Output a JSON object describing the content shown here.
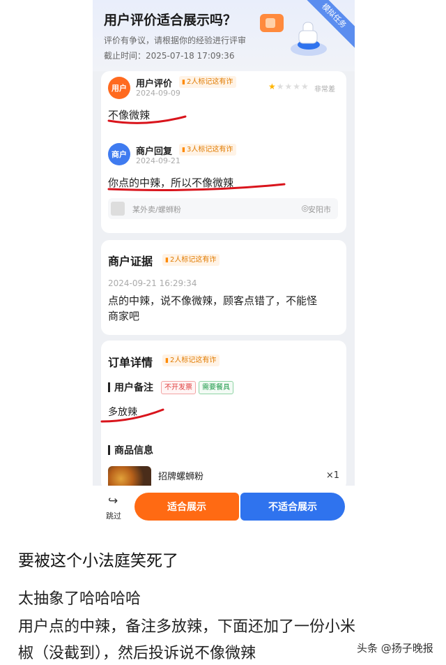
{
  "header": {
    "title": "用户评价适合展示吗？",
    "subtitle": "评价有争议，请根据你的经验进行评审",
    "deadline": "截止时间：2025-07-18 17:09:36",
    "ribbon": "模拟任务"
  },
  "review": {
    "user": {
      "avatar": "用户",
      "name": "用户评价",
      "tag": "2人标记这有诈",
      "date": "2024-09-09",
      "rating": 1,
      "rating_max": 5,
      "rating_text": "非常差",
      "text": "不像微辣"
    },
    "merchant": {
      "avatar": "商户",
      "name": "商户回复",
      "tag": "3人标记这有诈",
      "date": "2024-09-21",
      "text": "你点的中辣，所以不像微辣"
    },
    "store": {
      "name": "某外卖/螺蛳粉",
      "city": "安阳市",
      "icon": "location-pin-icon"
    }
  },
  "evidence": {
    "title": "商户证据",
    "tag": "2人标记这有诈",
    "time": "2024-09-21 16:29:34",
    "line1": "点的中辣，说不像微辣，顾客点错了，不能怪",
    "line2": "商家吧"
  },
  "order": {
    "title": "订单详情",
    "tag": "2人标记这有诈",
    "remark_label": "用户备注",
    "badges": [
      "不开发票",
      "需要餐具"
    ],
    "remark": "多放辣",
    "goods_label": "商品信息",
    "item_name": "招牌螺蛳粉",
    "item_qty": "×1"
  },
  "actions": {
    "skip": "跳过",
    "approve": "适合展示",
    "reject": "不适合展示"
  },
  "caption": {
    "title": "要被这个小法庭笑死了",
    "line1": "太抽象了哈哈哈哈",
    "line2": "用户点的中辣，备注多放辣，下面还加了一份小米",
    "line3": "椒（没截到），然后投诉说不像微辣"
  },
  "watermark": "头条 @扬子晚报",
  "colors": {
    "accent_orange": "#ff6a13",
    "accent_blue": "#2f73ee",
    "annotation_red": "#d9141c"
  }
}
